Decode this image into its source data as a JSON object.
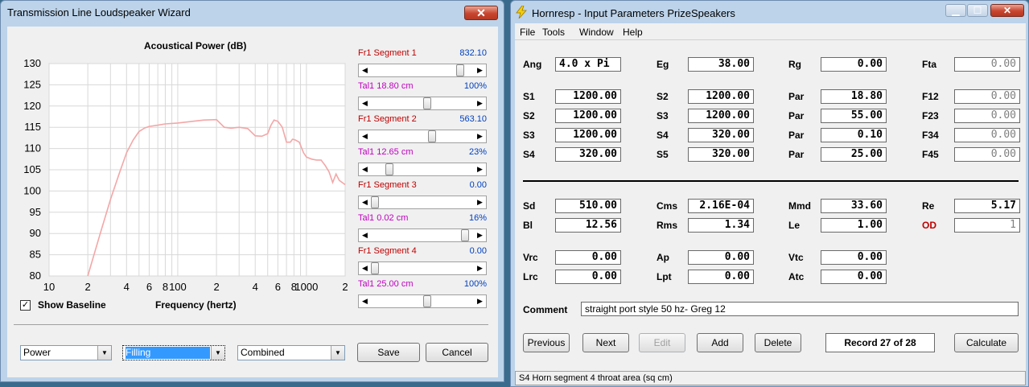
{
  "wizard": {
    "title": "Transmission Line Loudspeaker Wizard",
    "close_glyph": "✕",
    "chart_title": "Acoustical Power (dB)",
    "x_axis_label": "Frequency (hertz)",
    "show_baseline_label": "Show Baseline",
    "show_baseline_checked": true,
    "check_glyph": "✓",
    "segments": [
      {
        "label": "Fr1  Segment 1",
        "value": "832.10",
        "color": "#c00000",
        "position": 0.9
      },
      {
        "label": "Tal1  18.80 cm",
        "value": "100%",
        "color": "#c000c0",
        "position": 0.55
      },
      {
        "label": "Fr1  Segment 2",
        "value": "563.10",
        "color": "#c00000",
        "position": 0.6
      },
      {
        "label": "Tal1  12.65 cm",
        "value": "23%",
        "color": "#c000c0",
        "position": 0.15
      },
      {
        "label": "Fr1  Segment 3",
        "value": "0.00",
        "color": "#c00000",
        "position": 0.0
      },
      {
        "label": "Tal1  0.02 cm",
        "value": "16%",
        "color": "#c000c0",
        "position": 0.95
      },
      {
        "label": "Fr1  Segment 4",
        "value": "0.00",
        "color": "#c00000",
        "position": 0.0
      },
      {
        "label": "Tal1  25.00 cm",
        "value": "100%",
        "color": "#c000c0",
        "position": 0.55
      }
    ],
    "combos": [
      {
        "value": "Power",
        "selected": false
      },
      {
        "value": "Filling",
        "selected": true
      },
      {
        "value": "Combined",
        "selected": false
      }
    ],
    "save_label": "Save",
    "cancel_label": "Cancel"
  },
  "chart_data": {
    "type": "line",
    "title": "Acoustical Power (dB)",
    "xlabel": "Frequency (hertz)",
    "ylabel": "",
    "x_scale": "log",
    "xlim": [
      10,
      2000
    ],
    "ylim": [
      80,
      130
    ],
    "x_tick_labels": [
      "10",
      "2",
      "4",
      "6",
      "8",
      "100",
      "2",
      "4",
      "6",
      "8",
      "1000",
      "2"
    ],
    "y_tick_labels": [
      "130",
      "125",
      "120",
      "115",
      "110",
      "105",
      "100",
      "95",
      "90",
      "85",
      "80"
    ],
    "grid": true,
    "series": [
      {
        "color": "#f4a6a6",
        "x": [
          20,
          25,
          30,
          35,
          40,
          45,
          50,
          55,
          60,
          70,
          80,
          100,
          130,
          160,
          200,
          230,
          260,
          300,
          350,
          400,
          450,
          500,
          530,
          560,
          600,
          650,
          700,
          750,
          780,
          820,
          880,
          950,
          1000,
          1100,
          1200,
          1300,
          1400,
          1500,
          1600,
          1700,
          1800,
          2000
        ],
        "y": [
          80,
          90,
          98,
          104,
          109,
          112,
          114,
          114.8,
          115.2,
          115.5,
          115.8,
          116,
          116.4,
          116.7,
          116.8,
          115,
          114.8,
          115,
          114.7,
          113,
          112.9,
          113.5,
          115.5,
          116.7,
          116.4,
          115,
          111.5,
          111.5,
          112.2,
          112,
          111.5,
          109,
          108,
          107.5,
          107.3,
          107.3,
          106,
          104.5,
          102,
          104,
          102.5,
          101.5
        ]
      }
    ]
  },
  "hornresp": {
    "title": "Hornresp - Input Parameters   PrizeSpeakers",
    "menu": [
      "File",
      "Tools",
      "Window",
      "Help"
    ],
    "rows1": [
      [
        [
          "Ang",
          "4.0 x Pi",
          true
        ],
        [
          "Eg",
          "38.00",
          false
        ],
        [
          "Rg",
          "0.00",
          false
        ],
        [
          "Fta",
          "0.00",
          false
        ]
      ],
      [
        [
          "S1",
          "1200.00",
          false
        ],
        [
          "S2",
          "1200.00",
          false
        ],
        [
          "Par",
          "18.80",
          false
        ],
        [
          "F12",
          "0.00",
          false
        ]
      ],
      [
        [
          "S2",
          "1200.00",
          false
        ],
        [
          "S3",
          "1200.00",
          false
        ],
        [
          "Par",
          "55.00",
          false
        ],
        [
          "F23",
          "0.00",
          false
        ]
      ],
      [
        [
          "S3",
          "1200.00",
          false
        ],
        [
          "S4",
          "320.00",
          false
        ],
        [
          "Par",
          "0.10",
          false
        ],
        [
          "F34",
          "0.00",
          false
        ]
      ],
      [
        [
          "S4",
          "320.00",
          false
        ],
        [
          "S5",
          "320.00",
          false
        ],
        [
          "Par",
          "25.00",
          false
        ],
        [
          "F45",
          "0.00",
          false
        ]
      ]
    ],
    "rows2": [
      [
        [
          "Sd",
          "510.00"
        ],
        [
          "Cms",
          "2.16E-04"
        ],
        [
          "Mmd",
          "33.60"
        ],
        [
          "Re",
          "5.17"
        ]
      ],
      [
        [
          "Bl",
          "12.56"
        ],
        [
          "Rms",
          "1.34"
        ],
        [
          "Le",
          "1.00"
        ],
        [
          "OD",
          "1"
        ]
      ],
      [
        [
          "Vrc",
          "0.00"
        ],
        [
          "Ap",
          "0.00"
        ],
        [
          "Vtc",
          "0.00"
        ]
      ],
      [
        [
          "Lrc",
          "0.00"
        ],
        [
          "Lpt",
          "0.00"
        ],
        [
          "Atc",
          "0.00"
        ]
      ]
    ],
    "comment_label": "Comment",
    "comment_value": "straight port style 50 hz- Greg 12",
    "buttons": [
      {
        "label": "Previous",
        "disabled": false
      },
      {
        "label": "Next",
        "disabled": false
      },
      {
        "label": "Edit",
        "disabled": true
      },
      {
        "label": "Add",
        "disabled": false
      },
      {
        "label": "Delete",
        "disabled": false
      }
    ],
    "record_label": "Record 27 of 28",
    "calculate_label": "Calculate",
    "status_text": "S4   Horn segment 4 throat area  (sq cm)",
    "od_color": "#c00000"
  }
}
